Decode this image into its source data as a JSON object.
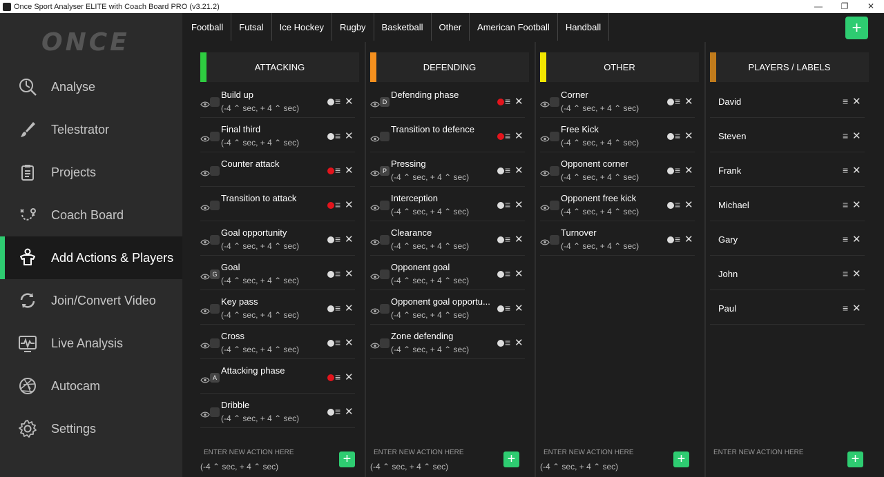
{
  "window": {
    "title": "Once Sport Analyser ELITE with Coach Board PRO (v3.21.2)",
    "minimize": "—",
    "maximize": "❐",
    "close": "✕"
  },
  "logo": "ONCE",
  "nav": [
    {
      "label": "Analyse",
      "icon": "analyse-icon"
    },
    {
      "label": "Telestrator",
      "icon": "brush-icon"
    },
    {
      "label": "Projects",
      "icon": "clipboard-icon"
    },
    {
      "label": "Coach Board",
      "icon": "tactics-icon"
    },
    {
      "label": "Add Actions & Players",
      "icon": "player-icon"
    },
    {
      "label": "Join/Convert Video",
      "icon": "convert-icon"
    },
    {
      "label": "Live Analysis",
      "icon": "live-icon"
    },
    {
      "label": "Autocam",
      "icon": "aperture-icon"
    },
    {
      "label": "Settings",
      "icon": "gear-icon"
    }
  ],
  "tabs": [
    "Football",
    "Futsal",
    "Ice Hockey",
    "Rugby",
    "Basketball",
    "Other",
    "American Football",
    "Handball"
  ],
  "add_symbol": "+",
  "columns": [
    {
      "title": "ATTACKING",
      "color": "#2ecc40",
      "actions": [
        {
          "name": "Build up",
          "key": "",
          "time": "(-4 ⌃ sec, + 4 ⌃ sec)",
          "red": false
        },
        {
          "name": "Final third",
          "key": "",
          "time": "(-4 ⌃ sec, + 4 ⌃ sec)",
          "red": false
        },
        {
          "name": "Counter attack",
          "key": "",
          "time": "",
          "red": true
        },
        {
          "name": "Transition to attack",
          "key": "",
          "time": "",
          "red": true
        },
        {
          "name": "Goal opportunity",
          "key": "",
          "time": "(-4 ⌃ sec, + 4 ⌃ sec)",
          "red": false
        },
        {
          "name": "Goal",
          "key": "G",
          "time": "(-4 ⌃ sec, + 4 ⌃ sec)",
          "red": false
        },
        {
          "name": "Key pass",
          "key": "",
          "time": "(-4 ⌃ sec, + 4 ⌃ sec)",
          "red": false
        },
        {
          "name": "Cross",
          "key": "",
          "time": "(-4 ⌃ sec, + 4 ⌃ sec)",
          "red": false
        },
        {
          "name": "Attacking phase",
          "key": "A",
          "time": "",
          "red": true
        },
        {
          "name": "Dribble",
          "key": "",
          "time": "(-4 ⌃ sec, + 4 ⌃ sec)",
          "red": false
        }
      ]
    },
    {
      "title": "DEFENDING",
      "color": "#f5901e",
      "actions": [
        {
          "name": "Defending phase",
          "key": "D",
          "time": "",
          "red": true
        },
        {
          "name": "Transition to defence",
          "key": "",
          "time": "",
          "red": true
        },
        {
          "name": "Pressing",
          "key": "P",
          "time": "(-4 ⌃ sec, + 4 ⌃ sec)",
          "red": false
        },
        {
          "name": "Interception",
          "key": "",
          "time": "(-4 ⌃ sec, + 4 ⌃ sec)",
          "red": false
        },
        {
          "name": "Clearance",
          "key": "",
          "time": "(-4 ⌃ sec, + 4 ⌃ sec)",
          "red": false
        },
        {
          "name": "Opponent goal",
          "key": "",
          "time": "(-4 ⌃ sec, + 4 ⌃ sec)",
          "red": false
        },
        {
          "name": "Opponent goal opportu...",
          "key": "",
          "time": "(-4 ⌃ sec, + 4 ⌃ sec)",
          "red": false
        },
        {
          "name": "Zone defending",
          "key": "",
          "time": "(-4 ⌃ sec, + 4 ⌃ sec)",
          "red": false
        }
      ]
    },
    {
      "title": "OTHER",
      "color": "#f2e600",
      "actions": [
        {
          "name": "Corner",
          "key": "",
          "time": "(-4 ⌃ sec, + 4 ⌃ sec)",
          "red": false
        },
        {
          "name": "Free Kick",
          "key": "",
          "time": "(-4 ⌃ sec, + 4 ⌃ sec)",
          "red": false
        },
        {
          "name": "Opponent corner",
          "key": "",
          "time": "(-4 ⌃ sec, + 4 ⌃ sec)",
          "red": false
        },
        {
          "name": "Opponent free kick",
          "key": "",
          "time": "(-4 ⌃ sec, + 4 ⌃ sec)",
          "red": false
        },
        {
          "name": "Turnover",
          "key": "",
          "time": "(-4 ⌃ sec, + 4 ⌃ sec)",
          "red": false
        }
      ]
    }
  ],
  "players_column": {
    "title": "PLAYERS / LABELS",
    "color": "#c07b1c",
    "players": [
      "David",
      "Steven",
      "Frank",
      "Michael",
      "Gary",
      "John",
      "Paul"
    ]
  },
  "new_action": {
    "placeholder": "ENTER NEW ACTION HERE",
    "time": "(-4 ⌃ sec, + 4 ⌃ sec)"
  },
  "icons": {
    "eye": "eye-icon",
    "menu": "≡",
    "delete": "✕"
  }
}
